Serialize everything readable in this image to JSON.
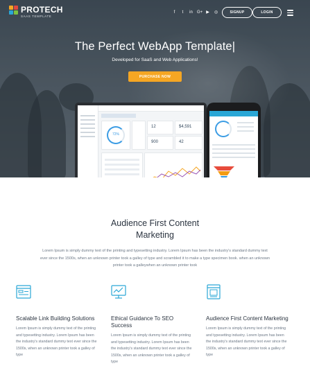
{
  "brand": {
    "name": "PROTECH",
    "tagline": "SAAS TEMPLATE",
    "colors": {
      "accent": "#f5a623",
      "icon": "#2aa7d6",
      "heading": "#2b3440",
      "text": "#6b7785"
    }
  },
  "header": {
    "social": [
      {
        "icon": "facebook-icon",
        "glyph": "f"
      },
      {
        "icon": "twitter-icon",
        "glyph": "t"
      },
      {
        "icon": "linkedin-icon",
        "glyph": "in"
      },
      {
        "icon": "google-plus-icon",
        "glyph": "G+"
      },
      {
        "icon": "youtube-icon",
        "glyph": "▶"
      },
      {
        "icon": "instagram-icon",
        "glyph": "◎"
      }
    ],
    "signup": "SIGNUP",
    "login": "LOGIN",
    "menu_icon": "hamburger-icon"
  },
  "hero": {
    "title": "The Perfect WebApp Template|",
    "subtitle": "Developed for SaaS and Web Applications!",
    "cta": "PURCHASE NOW"
  },
  "dashboard": {
    "progress": "72%",
    "stat1": "12",
    "stat2": "$4,591",
    "stat3": "900",
    "stat4": "42"
  },
  "intro": {
    "title": "Audience First Content Marketing",
    "text": "Lorem Ipsum is simply dummy text of the printing and typesetting industry. Lorem Ipsum has been the industry's standard dummy text ever since the 1500s, when an unknown printer took a galley of type and scrambled it to make a type specimen book. when an unknown printer took a galleywhen an unknown printer took"
  },
  "features": [
    {
      "icon": "link-building-icon",
      "title": "Scalable Link Building Solutions",
      "text": "Lorem Ipsum is simply dummy text of the printing and typesetting industry. Lorem Ipsum has been the industry's standard dummy text ever since the 1500s, when an unknown printer took a galley of type"
    },
    {
      "icon": "seo-chart-icon",
      "title": "Ethical Guidance To SEO Success",
      "text": "Lorem Ipsum is simply dummy text of the printing and typesetting industry. Lorem Ipsum has been the industry's standard dummy text ever since the 1500s, when an unknown printer took a galley of type"
    },
    {
      "icon": "content-marketing-icon",
      "title": "Audience First Content Marketing",
      "text": "Lorem Ipsum is simply dummy text of the printing and typesetting industry. Lorem Ipsum has been the industry's standard dummy text ever since the 1500s, when an unknown printer took a galley of type"
    }
  ]
}
